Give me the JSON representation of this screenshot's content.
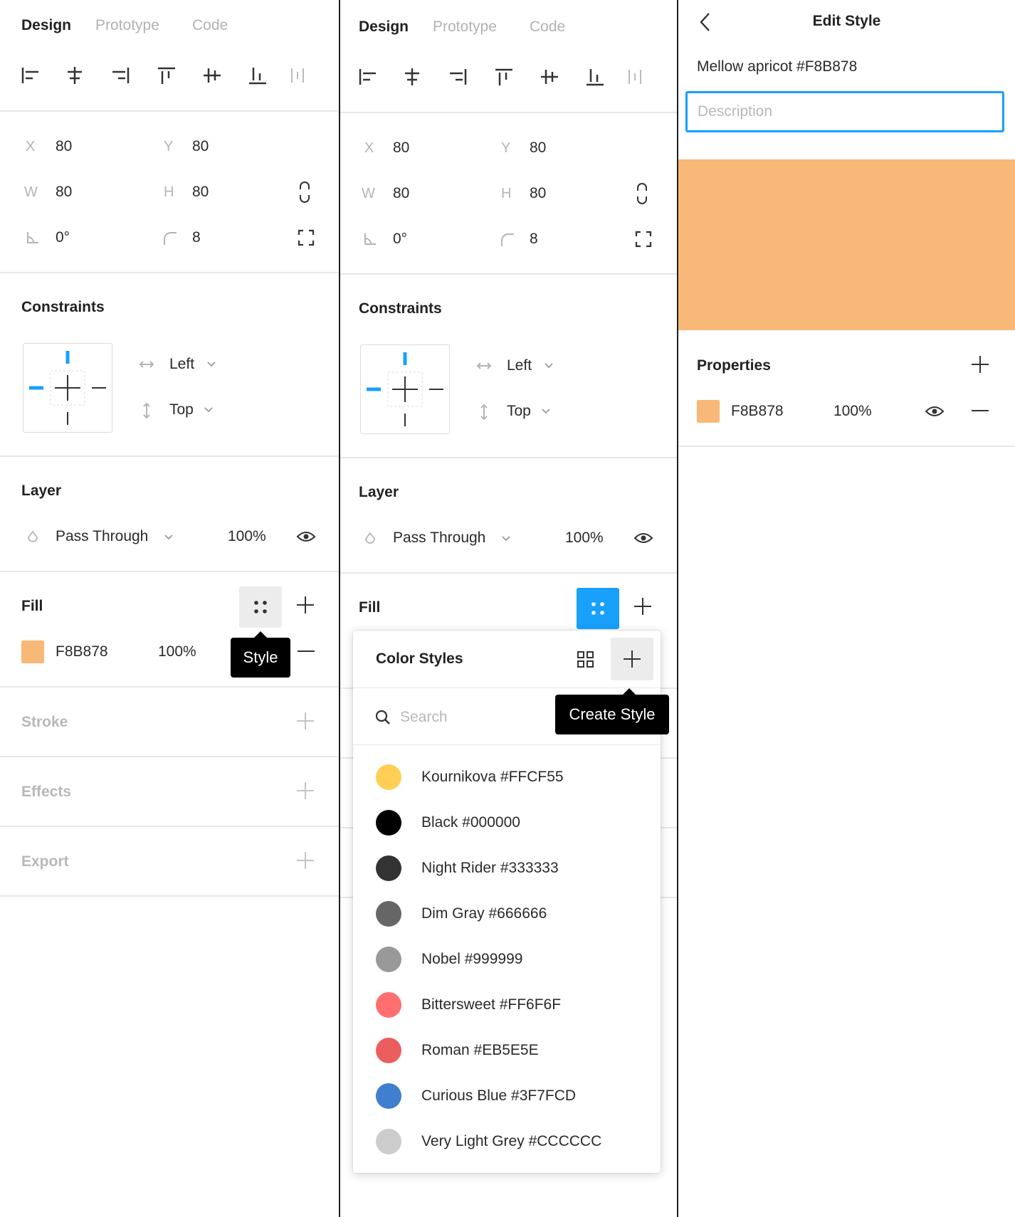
{
  "tabs": [
    "Design",
    "Prototype",
    "Code"
  ],
  "transform": {
    "x_label": "X",
    "x_value": "80",
    "y_label": "Y",
    "y_value": "80",
    "w_label": "W",
    "w_value": "80",
    "h_label": "H",
    "h_value": "80",
    "rotation_value": "0°",
    "radius_value": "8"
  },
  "constraints": {
    "title": "Constraints",
    "horizontal": "Left",
    "vertical": "Top"
  },
  "layer": {
    "title": "Layer",
    "blend_mode": "Pass Through",
    "opacity": "100%"
  },
  "fill": {
    "title": "Fill",
    "hex": "F8B878",
    "opacity": "100%",
    "color": "#F8B878"
  },
  "tooltips": {
    "style": "Style",
    "create_style": "Create Style"
  },
  "sections": {
    "stroke": "Stroke",
    "effects": "Effects",
    "export": "Export"
  },
  "color_styles": {
    "title": "Color Styles",
    "search_placeholder": "Search",
    "items": [
      {
        "label": "Kournikova #FFCF55",
        "color": "#FFCF55"
      },
      {
        "label": "Black #000000",
        "color": "#000000"
      },
      {
        "label": "Night Rider #333333",
        "color": "#333333"
      },
      {
        "label": "Dim Gray #666666",
        "color": "#666666"
      },
      {
        "label": "Nobel #999999",
        "color": "#999999"
      },
      {
        "label": "Bittersweet #FF6F6F",
        "color": "#FF6F6F"
      },
      {
        "label": "Roman #EB5E5E",
        "color": "#EB5E5E"
      },
      {
        "label": "Curious Blue #3F7FCD",
        "color": "#3F7FCD"
      },
      {
        "label": "Very Light Grey #CCCCCC",
        "color": "#CCCCCC"
      }
    ]
  },
  "edit_style": {
    "title": "Edit Style",
    "name": "Mellow apricot #F8B878",
    "description_placeholder": "Description",
    "preview_color": "#F8B878",
    "properties_title": "Properties",
    "hex": "F8B878",
    "opacity": "100%"
  },
  "colors": {
    "accent": "#18A0FB",
    "tooltip_bg": "#000000",
    "separator": "#1F1F1F"
  }
}
